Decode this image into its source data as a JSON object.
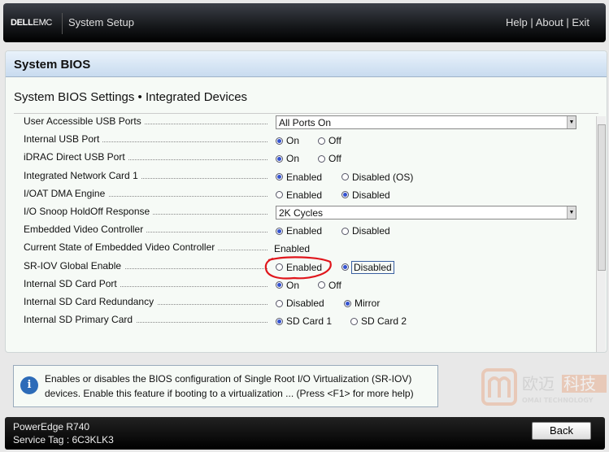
{
  "header": {
    "logo": "DELL",
    "logo_suffix": "EMC",
    "title": "System Setup",
    "help": "Help",
    "about": "About",
    "exit": "Exit",
    "sep": "|"
  },
  "panel": {
    "title": "System BIOS",
    "subtitle": "System BIOS Settings • Integrated Devices"
  },
  "settings": [
    {
      "label": "User Accessible USB Ports",
      "value": "All Ports On"
    },
    {
      "label": "Internal USB Port",
      "options": [
        "On",
        "Off"
      ],
      "selected": "On"
    },
    {
      "label": "iDRAC Direct USB Port",
      "options": [
        "On",
        "Off"
      ],
      "selected": "On"
    },
    {
      "label": "Integrated Network Card 1",
      "options": [
        "Enabled",
        "Disabled (OS)"
      ],
      "selected": "Enabled"
    },
    {
      "label": "I/OAT DMA Engine",
      "options": [
        "Enabled",
        "Disabled"
      ],
      "selected": "Disabled"
    },
    {
      "label": "I/O Snoop HoldOff Response",
      "value": "2K Cycles"
    },
    {
      "label": "Embedded Video Controller",
      "options": [
        "Enabled",
        "Disabled"
      ],
      "selected": "Enabled"
    },
    {
      "label": "Current State of Embedded Video Controller",
      "value": "Enabled"
    },
    {
      "label": "SR-IOV Global Enable",
      "options": [
        "Enabled",
        "Disabled"
      ],
      "selected": "Disabled"
    },
    {
      "label": "Internal SD Card Port",
      "options": [
        "On",
        "Off"
      ],
      "selected": "On"
    },
    {
      "label": "Internal SD Card Redundancy",
      "options": [
        "Disabled",
        "Mirror"
      ],
      "selected": "Mirror"
    },
    {
      "label": "Internal SD Primary Card",
      "options": [
        "SD Card 1",
        "SD Card 2"
      ],
      "selected": "SD Card 1"
    }
  ],
  "help_text": {
    "line1": "Enables or disables the BIOS configuration of Single Root I/O Virtualization (SR-IOV)",
    "line2": "devices. Enable this feature if booting to a virtualization ... (Press <F1> for more help)"
  },
  "watermark": {
    "cn": "欧迈科技",
    "en": "OMAI TECHNOLOGY"
  },
  "footer": {
    "model": "PowerEdge R740",
    "service_tag": "Service Tag : 6C3KLK3",
    "back": "Back"
  },
  "colors": {
    "annotation": "#e0161c",
    "radio": "#3352d0"
  }
}
